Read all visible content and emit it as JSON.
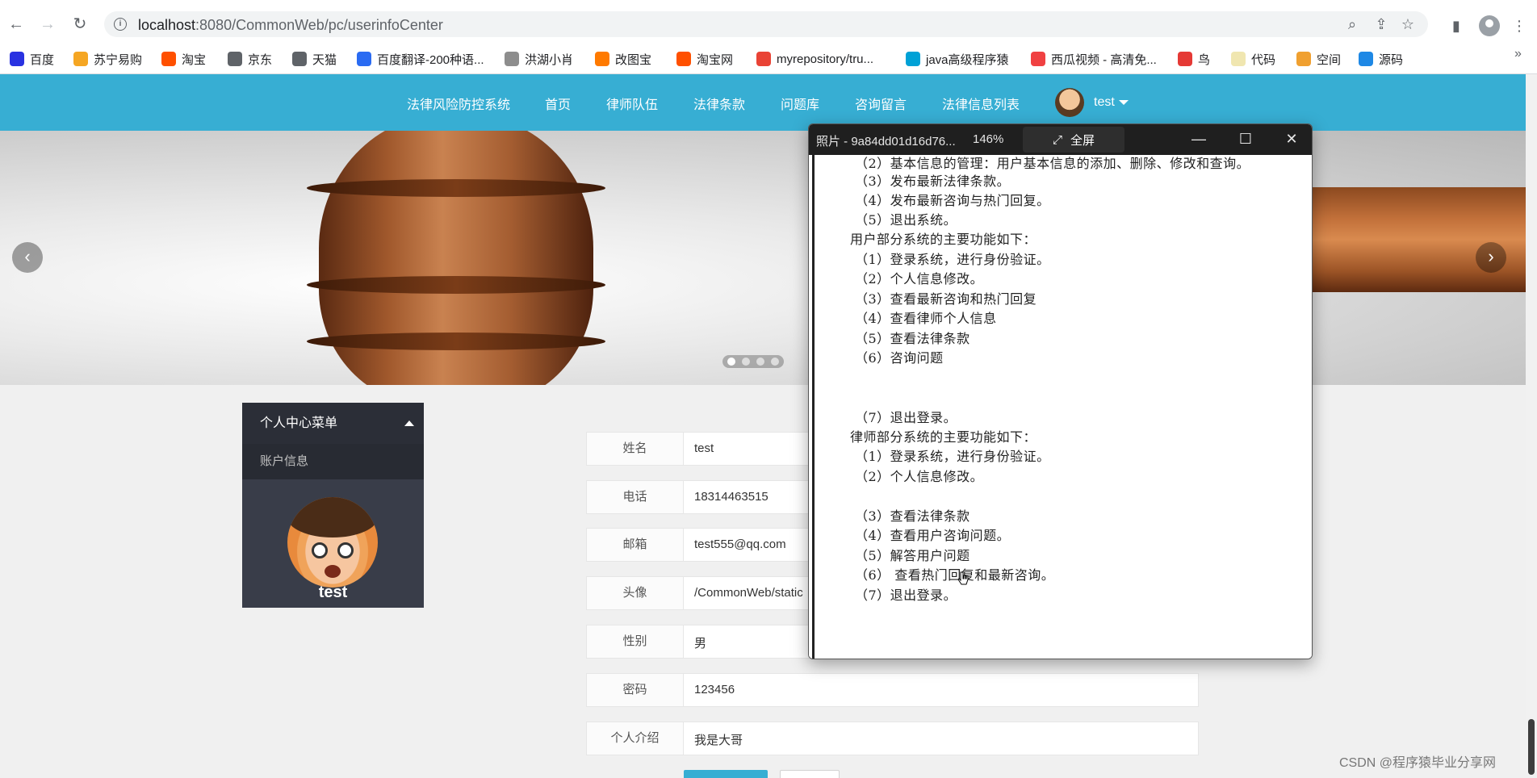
{
  "browser": {
    "url_host": "localhost",
    "url_path": ":8080/CommonWeb/pc/userinfoCenter",
    "bookmarks": [
      {
        "label": "百度",
        "color": "#2932e1"
      },
      {
        "label": "苏宁易购",
        "color": "#f5a623"
      },
      {
        "label": "淘宝",
        "color": "#ff5000"
      },
      {
        "label": "京东",
        "color": "#5f6368"
      },
      {
        "label": "天猫",
        "color": "#5f6368"
      },
      {
        "label": "百度翻译-200种语...",
        "color": "#2a6bf2"
      },
      {
        "label": "洪湖小肖",
        "color": "#8d8d8d"
      },
      {
        "label": "改图宝",
        "color": "#ff7a00"
      },
      {
        "label": "淘宝网",
        "color": "#ff5000"
      },
      {
        "label": "myrepository/tru...",
        "color": "#e94335"
      },
      {
        "label": "java高级程序猿",
        "color": "#00a1d6"
      },
      {
        "label": "西瓜视频 - 高清免...",
        "color": "#f04142"
      },
      {
        "label": "鸟",
        "color": "#e53935"
      },
      {
        "label": "代码",
        "color": "#f0e6b0"
      },
      {
        "label": "空间",
        "color": "#f0a030"
      },
      {
        "label": "源码",
        "color": "#1e88e5"
      }
    ],
    "more": "»"
  },
  "site": {
    "nav": [
      "法律风险防控系统",
      "首页",
      "律师队伍",
      "法律条款",
      "问题库",
      "咨询留言",
      "法律信息列表"
    ],
    "username": "test"
  },
  "carousel": {
    "prev": "‹",
    "next": "›",
    "dot_count": 4,
    "active_dot": 0
  },
  "menu": {
    "title": "个人中心菜单",
    "items": [
      "账户信息"
    ],
    "avatar_name": "test"
  },
  "form": {
    "fields": [
      {
        "label": "姓名",
        "value": "test"
      },
      {
        "label": "电话",
        "value": "18314463515"
      },
      {
        "label": "邮箱",
        "value": "test555@qq.com"
      },
      {
        "label": "头像",
        "value": "/CommonWeb/static"
      },
      {
        "label": "性别",
        "value": "男"
      },
      {
        "label": "密码",
        "value": "123456"
      },
      {
        "label": "个人介绍",
        "value": "我是大哥"
      }
    ]
  },
  "viewer": {
    "title": "照片 - 9a84dd01d16d76...",
    "zoom": "146%",
    "fullscreen": "全屏",
    "lines": [
      "（2）基本信息的管理：用户基本信息的添加、删除、修改和查询。",
      "（3）发布最新法律条款。",
      "（4）发布最新咨询与热门回复。",
      "（5）退出系统。",
      "用户部分系统的主要功能如下：",
      "（1）登录系统，进行身份验证。",
      "（2）个人信息修改。",
      "（3）查看最新咨询和热门回复",
      "（4）查看律师个人信息",
      "（5）查看法律条款",
      "（6）咨询问题",
      "（7）退出登录。",
      "律师部分系统的主要功能如下：",
      "（1）登录系统，进行身份验证。",
      "（2）个人信息修改。",
      "（3）查看法律条款",
      "（4）查看用户咨询问题。",
      "（5）解答用户问题",
      "（6）  查看热门回复和最新咨询。",
      "（7）退出登录。"
    ]
  },
  "watermark": "CSDN @程序猿毕业分享网"
}
